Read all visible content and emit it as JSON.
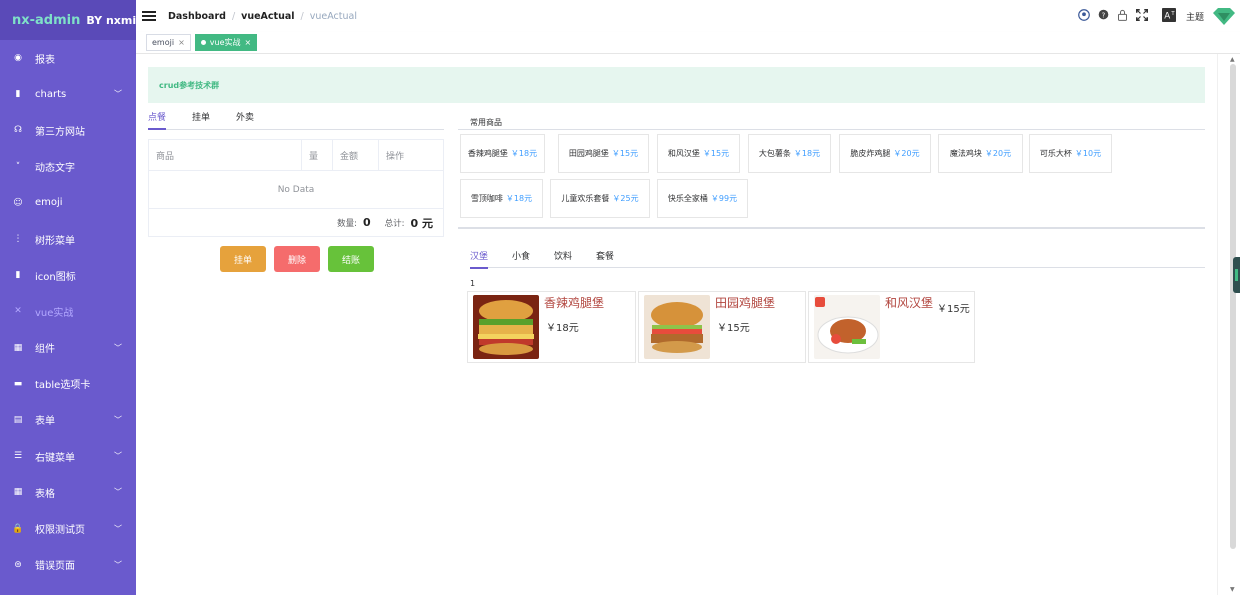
{
  "app": {
    "brand": "nx-admin",
    "by": "BY nxmin"
  },
  "sidebar": {
    "items": [
      {
        "label": "报表",
        "icon": "dashboard-icon",
        "glyph": "◉",
        "has_children": false
      },
      {
        "label": "charts",
        "icon": "bar-chart-icon",
        "glyph": "▮",
        "has_children": true
      },
      {
        "label": "第三方网站",
        "icon": "link-icon",
        "glyph": "☊",
        "has_children": false
      },
      {
        "label": "动态文字",
        "icon": "text-icon",
        "glyph": "˅",
        "has_children": false
      },
      {
        "label": "emoji",
        "icon": "emoji-icon",
        "glyph": "☺",
        "has_children": false
      },
      {
        "label": "树形菜单",
        "icon": "tree-icon",
        "glyph": "⋮",
        "has_children": false
      },
      {
        "label": "icon图标",
        "icon": "icon-icon",
        "glyph": "▮",
        "has_children": false
      },
      {
        "label": "vue实战",
        "icon": "close-x-icon",
        "glyph": "✕",
        "has_children": false,
        "active": true
      },
      {
        "label": "组件",
        "icon": "component-icon",
        "glyph": "▦",
        "has_children": true
      },
      {
        "label": "table选项卡",
        "icon": "table-tab-icon",
        "glyph": "▬",
        "has_children": false
      },
      {
        "label": "表单",
        "icon": "form-icon",
        "glyph": "▤",
        "has_children": true
      },
      {
        "label": "右键菜单",
        "icon": "list-icon",
        "glyph": "☰",
        "has_children": true
      },
      {
        "label": "表格",
        "icon": "grid-icon",
        "glyph": "▦",
        "has_children": true
      },
      {
        "label": "权限测试页",
        "icon": "lock-icon",
        "glyph": "🔒",
        "has_children": true
      },
      {
        "label": "错误页面",
        "icon": "error-icon",
        "glyph": "⊜",
        "has_children": true
      }
    ]
  },
  "header": {
    "breadcrumb": [
      "Dashboard",
      "vueActual",
      "vueActual"
    ],
    "theme_label": "主题",
    "icons": [
      "github-icon",
      "help-icon",
      "lock-icon",
      "fullscreen-icon",
      "font-size-icon"
    ]
  },
  "tags": [
    {
      "label": "emoji",
      "active": false
    },
    {
      "label": "vue实战",
      "active": true
    }
  ],
  "alert": {
    "text": "crud参考技术群"
  },
  "left_tabs": [
    "点餐",
    "挂单",
    "外卖"
  ],
  "order_table": {
    "columns": [
      "商品",
      "量",
      "金额",
      "操作"
    ],
    "empty_text": "No Data",
    "count_label": "数量:",
    "count_value": "0",
    "total_label": "总计:",
    "total_value": "0 元"
  },
  "buttons": {
    "hang": "挂单",
    "delete": "删除",
    "checkout": "结账"
  },
  "common_goods": {
    "title": "常用商品",
    "items": [
      {
        "name": "香辣鸡腿堡",
        "price": "￥18元"
      },
      {
        "name": "田园鸡腿堡",
        "price": "￥15元"
      },
      {
        "name": "和风汉堡",
        "price": "￥15元"
      },
      {
        "name": "大包薯条",
        "price": "￥18元"
      },
      {
        "name": "脆皮炸鸡腿",
        "price": "￥20元"
      },
      {
        "name": "魔法鸡块",
        "price": "￥20元"
      },
      {
        "name": "可乐大杯",
        "price": "￥10元"
      },
      {
        "name": "雪顶咖啡",
        "price": "￥18元"
      },
      {
        "name": "儿童欢乐套餐",
        "price": "￥25元"
      },
      {
        "name": "快乐全家桶",
        "price": "￥99元"
      }
    ]
  },
  "food_tabs": [
    "汉堡",
    "小食",
    "饮料",
    "套餐"
  ],
  "page_number": "1",
  "foods": [
    {
      "name": "香辣鸡腿堡",
      "price": "￥18元"
    },
    {
      "name": "田园鸡腿堡",
      "price": "￥15元"
    },
    {
      "name": "和风汉堡",
      "price": "￥15元"
    }
  ],
  "colors": {
    "sidebar": "#6a5acd",
    "accent": "#42b983",
    "price": "#409eff",
    "food_name": "#b2463f"
  }
}
